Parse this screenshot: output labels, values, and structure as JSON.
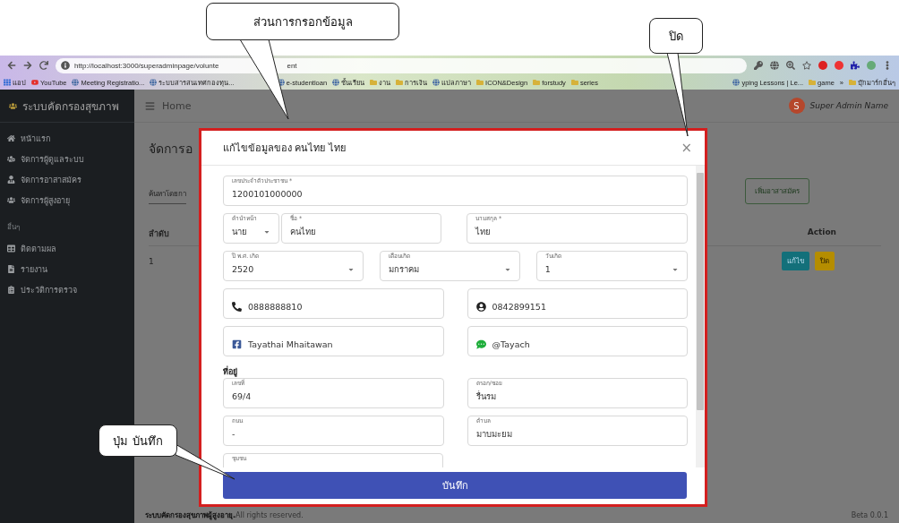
{
  "callouts": [
    {
      "text": "ส่วนการกรอกข้อมูล"
    },
    {
      "text": "ปิด"
    },
    {
      "text": "ปุ่ม บันทึก"
    }
  ],
  "browser": {
    "url_parts": [
      "http://localhost:3000/superadminpage/volunte",
      "ent"
    ],
    "bookmarks": [
      {
        "label": "แอป",
        "kind": "apps"
      },
      {
        "label": "YouTube",
        "kind": "youtube"
      },
      {
        "label": "Meeting Registratio...",
        "kind": "site"
      },
      {
        "label": "ระบบสารสนเทศกองทุน...",
        "kind": "site"
      },
      {
        "label": "e-studentloan",
        "kind": "site"
      },
      {
        "label": "ชั้นเรียน",
        "kind": "site"
      },
      {
        "label": "งาน",
        "kind": "folder"
      },
      {
        "label": "การเงิน",
        "kind": "folder"
      },
      {
        "label": "แปลภาษา",
        "kind": "site"
      },
      {
        "label": "ICON&Design",
        "kind": "folder"
      },
      {
        "label": "forstudy",
        "kind": "folder"
      },
      {
        "label": "series",
        "kind": "folder"
      },
      {
        "label": "yping Lessons | Le...",
        "kind": "site"
      },
      {
        "label": "game",
        "kind": "folder"
      },
      {
        "label": "»",
        "kind": "more"
      },
      {
        "label": "บุ๊กมาร์กอื่นๆ",
        "kind": "folder"
      }
    ]
  },
  "sidebar": {
    "brand": "ระบบคัดกรองสุขภาพ",
    "items": [
      {
        "label": "หน้าแรก"
      },
      {
        "label": "จัดการผู้ดูแลระบบ"
      },
      {
        "label": "จัดการอาสาสมัคร"
      },
      {
        "label": "จัดการผู้สูงอายุ"
      }
    ],
    "section": "อื่นๆ",
    "other_items": [
      {
        "label": "ติดตามผล"
      },
      {
        "label": "รายงาน"
      },
      {
        "label": "ประวัติการตรวจ"
      }
    ]
  },
  "navbar": {
    "home": "Home",
    "avatar": "S",
    "user": "Super Admin Name"
  },
  "page": {
    "title": "จัดการอ",
    "search_placeholder": "ค้นหาโดยกา",
    "add_button": "เพิ่มอาสาสมัคร",
    "columns": [
      "ลำดับ",
      "Action"
    ],
    "rows": [
      {
        "index": "1",
        "edit": "แก้ไข",
        "close": "ปิด"
      }
    ]
  },
  "footer": {
    "brand": "ระบบคัดกรองสุขภาพผู้สูงอายุ.",
    "rights": "All rights reserved.",
    "version": "Beta 0.0.1"
  },
  "modal": {
    "title": "แก้ไขข้อมูลของ คนไทย ไทย",
    "close": "×",
    "rows": [
      {
        "fields": [
          {
            "label": "เลขประจำตัวประชาชน *",
            "value": "1200101000000",
            "kind": "text"
          }
        ]
      },
      {
        "fields": [
          {
            "label": "คำนำหน้า",
            "value": "นาย",
            "kind": "select"
          },
          {
            "label": "ชื่อ *",
            "value": "คนไทย",
            "kind": "text"
          },
          {
            "label": "นามสกุล *",
            "value": "ไทย",
            "kind": "text"
          }
        ]
      },
      {
        "fields": [
          {
            "label": "ปี พ.ศ. เกิด",
            "value": "2520",
            "kind": "select"
          },
          {
            "label": "เดือนเกิด",
            "value": "มกราคม",
            "kind": "select"
          },
          {
            "label": "วันเกิด",
            "value": "1",
            "kind": "select"
          }
        ]
      },
      {
        "fields": [
          {
            "value": "0888888810",
            "kind": "phone"
          },
          {
            "value": "0842899151",
            "kind": "contact"
          }
        ]
      },
      {
        "fields": [
          {
            "value": "Tayathai Mhaitawan",
            "kind": "facebook"
          },
          {
            "value": "@Tayach",
            "kind": "line"
          }
        ]
      }
    ],
    "address_heading": "ที่อยู่",
    "address_rows": [
      {
        "fields": [
          {
            "label": "เลขที่",
            "value": "69/4",
            "kind": "text"
          },
          {
            "label": "ตรอก/ซอย",
            "value": "รื่นรม",
            "kind": "text"
          }
        ]
      },
      {
        "fields": [
          {
            "label": "ถนน",
            "value": "-",
            "kind": "text"
          },
          {
            "label": "ตำบล",
            "value": "มาบมะยม",
            "kind": "text"
          }
        ]
      },
      {
        "fields": [
          {
            "label": "ชุมชน",
            "kind": "text"
          }
        ]
      }
    ],
    "save": "บันทึก"
  }
}
